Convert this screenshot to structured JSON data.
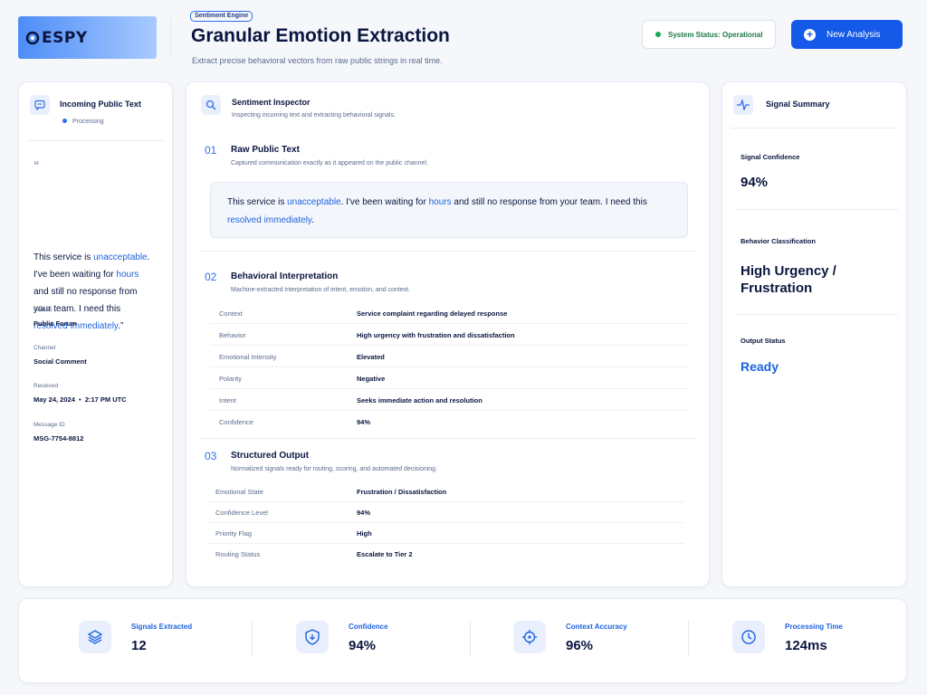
{
  "brand": {
    "logo": "ESPY"
  },
  "header": {
    "badge": "Sentiment Engine",
    "title": "Granular Emotion Extraction",
    "subtitle": "Extract precise behavioral vectors from raw public strings in real time.",
    "status": "System Status: Operational",
    "new_button": "New Analysis"
  },
  "incoming": {
    "title": "Incoming Public Text",
    "status": "Processing",
    "quote_parts": [
      "This service is ",
      "unacceptable",
      ". I've been waiting for ",
      "hours",
      " and still no response from your team. I need this ",
      "resolved immediately",
      ".”"
    ],
    "meta": [
      {
        "label": "Source",
        "value": "Public Forum"
      },
      {
        "label": "Channel",
        "value": "Social Comment"
      },
      {
        "label": "Received",
        "value": "May 24, 2024  •  2:17 PM UTC"
      },
      {
        "label": "Message ID",
        "value": "MSG-7754-8812"
      }
    ]
  },
  "inspector": {
    "title": "Sentiment Inspector",
    "subtitle": "Inspecting incoming text and extracting behavioral signals.",
    "sections": [
      {
        "num": "01",
        "title": "Raw Public Text",
        "subtitle": "Captured communication exactly as it appeared on the public channel."
      },
      {
        "num": "02",
        "title": "Behavioral Interpretation",
        "subtitle": "Machine-extracted interpretation of intent, emotion, and context."
      },
      {
        "num": "03",
        "title": "Structured Output",
        "subtitle": "Normalized signals ready for routing, scoring, and automated decisioning."
      }
    ],
    "raw_parts": [
      "This service is ",
      "unacceptable",
      ". I've been waiting for ",
      "hours",
      " and still no response from your team. I need this ",
      "resolved immediately",
      "."
    ],
    "interpretation": [
      {
        "key": "Context",
        "value": "Service complaint regarding delayed response"
      },
      {
        "key": "Behavior",
        "value": "High urgency with frustration and dissatisfaction"
      },
      {
        "key": "Emotional Intensity",
        "value": "Elevated"
      },
      {
        "key": "Polarity",
        "value": "Negative"
      },
      {
        "key": "Intent",
        "value": "Seeks immediate action and resolution"
      },
      {
        "key": "Confidence",
        "value": "94%"
      }
    ],
    "output": [
      {
        "key": "Emotional State",
        "value": "Frustration / Dissatisfaction"
      },
      {
        "key": "Confidence Level",
        "value": "94%"
      },
      {
        "key": "Priority Flag",
        "value": "High"
      },
      {
        "key": "Routing Status",
        "value": "Escalate to Tier 2"
      }
    ]
  },
  "summary": {
    "title": "Signal Summary",
    "items": [
      {
        "label": "Signal Confidence",
        "value": "94%"
      },
      {
        "label": "Behavior Classification",
        "value": "High Urgency / Frustration"
      },
      {
        "label": "Output Status",
        "value": "Ready"
      }
    ]
  },
  "stats": [
    {
      "label": "Signals Extracted",
      "value": "12",
      "icon": "layers-icon"
    },
    {
      "label": "Confidence",
      "value": "94%",
      "icon": "shield-icon"
    },
    {
      "label": "Context Accuracy",
      "value": "96%",
      "icon": "target-icon"
    },
    {
      "label": "Processing Time",
      "value": "124ms",
      "icon": "clock-icon"
    }
  ],
  "colors": {
    "accent": "#1459e8",
    "highlight": "#1f63e0",
    "ok": "#18a957",
    "text": "#0b1640"
  }
}
